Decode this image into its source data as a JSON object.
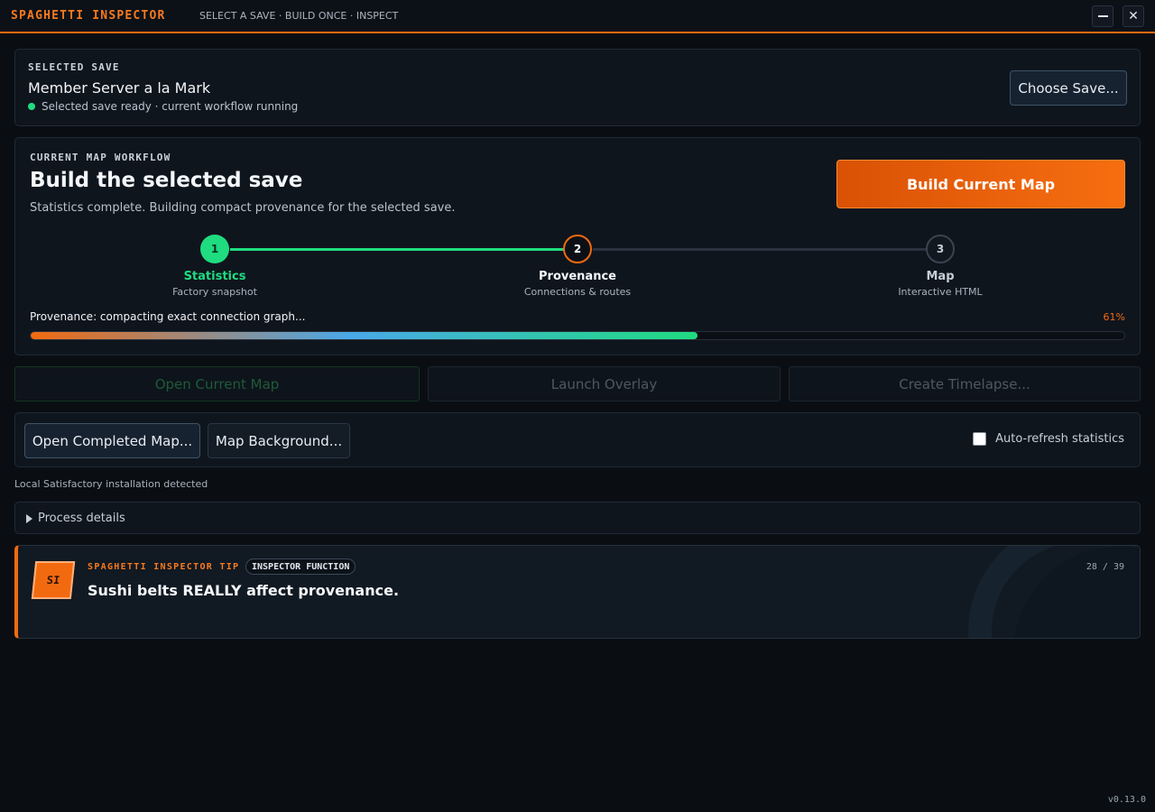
{
  "titlebar": {
    "app_title": "SPAGHETTI INSPECTOR",
    "subtitle": "SELECT A SAVE · BUILD ONCE · INSPECT",
    "close_glyph": "✕"
  },
  "selected_save": {
    "eyebrow": "SELECTED SAVE",
    "name": "Member Server a la Mark",
    "status": "Selected save ready · current workflow running",
    "status_color": "#1fdc80",
    "choose_label": "Choose Save..."
  },
  "workflow": {
    "eyebrow": "CURRENT MAP WORKFLOW",
    "title": "Build the selected save",
    "description": "Statistics complete. Building compact provenance for the selected save.",
    "build_label": "Build Current Map",
    "steps": [
      {
        "number": "1",
        "label": "Statistics",
        "sub": "Factory snapshot",
        "state": "done"
      },
      {
        "number": "2",
        "label": "Provenance",
        "sub": "Connections & routes",
        "state": "active"
      },
      {
        "number": "3",
        "label": "Map",
        "sub": "Interactive HTML",
        "state": "pending"
      }
    ],
    "progress_text": "Provenance: compacting exact connection graph...",
    "progress_pct_label": "61%",
    "progress_value": 61
  },
  "actions": {
    "open_current": "Open Current Map",
    "launch_overlay": "Launch Overlay",
    "create_timelapse": "Create Timelapse..."
  },
  "secondary": {
    "open_completed": "Open Completed Map...",
    "map_background": "Map Background...",
    "auto_refresh_label": "Auto-refresh statistics",
    "auto_refresh_checked": false
  },
  "install_status": "Local Satisfactory installation detected",
  "details": {
    "label": "Process details"
  },
  "tip": {
    "logo": "SI",
    "eyebrow": "SPAGHETTI INSPECTOR TIP",
    "badge": "INSPECTOR FUNCTION",
    "count": "28 / 39",
    "text": "Sushi belts REALLY affect provenance."
  },
  "version": "v0.13.0",
  "colors": {
    "accent": "#f26a10",
    "success": "#1fdc80",
    "background": "#0a0e13"
  }
}
